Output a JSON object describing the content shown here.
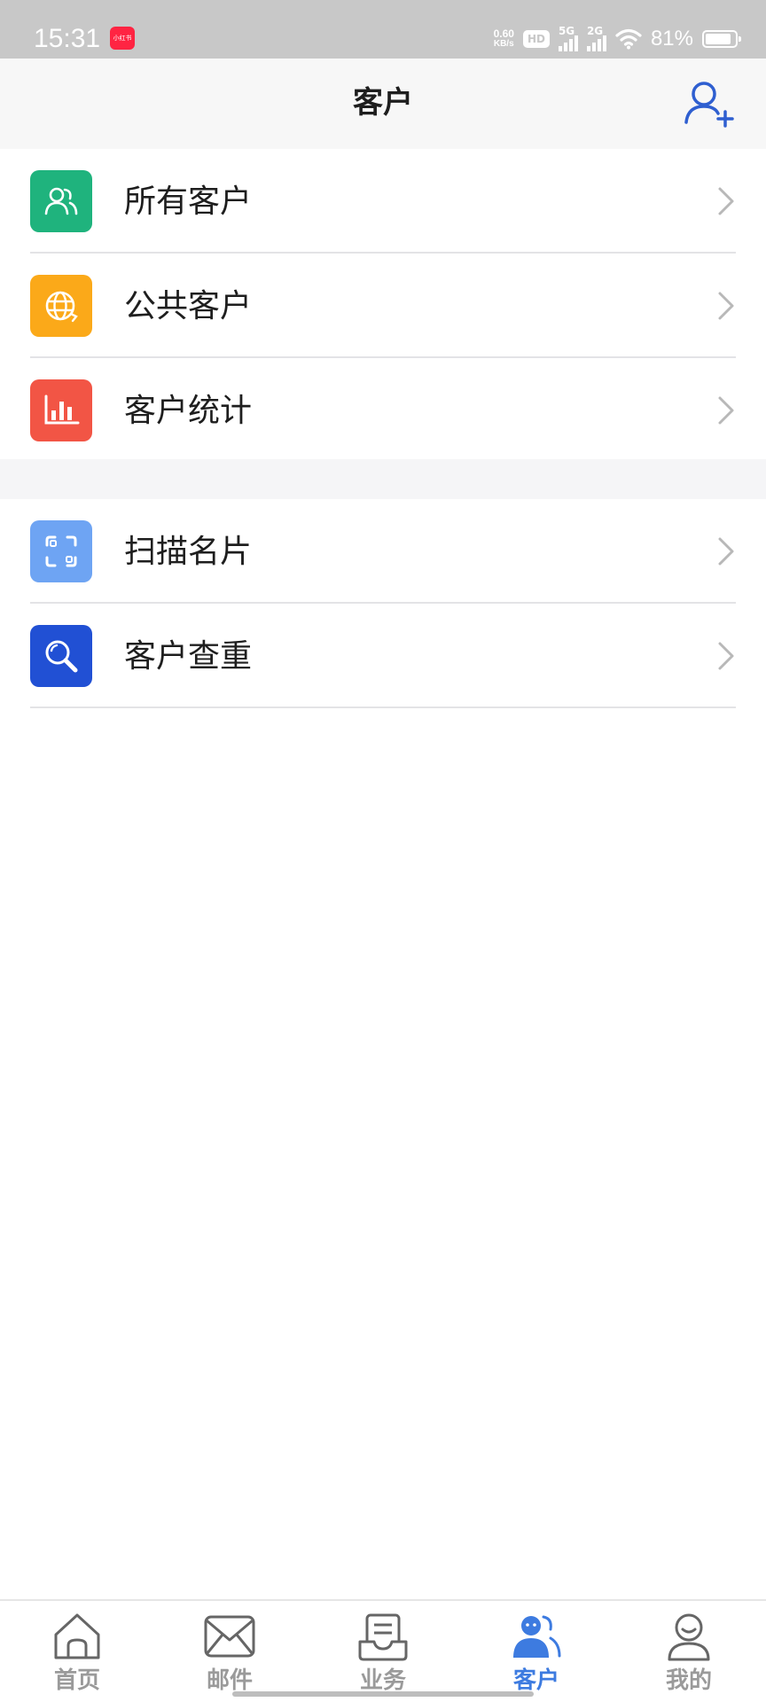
{
  "status_bar": {
    "time": "15:31",
    "app_badge": "小红书",
    "net_speed_value": "0.60",
    "net_speed_unit": "KB/s",
    "hd": "HD",
    "signal_1": "5G",
    "signal_2": "2G",
    "battery": "81%"
  },
  "header": {
    "title": "客户",
    "add_icon": "add-user-icon"
  },
  "groups": [
    {
      "items": [
        {
          "label": "所有客户",
          "icon": "users-icon",
          "color": "#1fb37d"
        },
        {
          "label": "公共客户",
          "icon": "globe-icon",
          "color": "#fba919"
        },
        {
          "label": "客户统计",
          "icon": "bar-chart-icon",
          "color": "#f25545"
        }
      ]
    },
    {
      "items": [
        {
          "label": "扫描名片",
          "icon": "scan-icon",
          "color": "#6ea4f3"
        },
        {
          "label": "客户查重",
          "icon": "magnifier-icon",
          "color": "#2150d4"
        }
      ]
    }
  ],
  "bottom_nav": {
    "active_index": 3,
    "active_color": "#3d7be0",
    "inactive_color": "#9a9a9a",
    "items": [
      {
        "label": "首页",
        "icon": "home-icon"
      },
      {
        "label": "邮件",
        "icon": "mail-icon"
      },
      {
        "label": "业务",
        "icon": "business-icon"
      },
      {
        "label": "客户",
        "icon": "customers-icon"
      },
      {
        "label": "我的",
        "icon": "profile-icon"
      }
    ]
  }
}
